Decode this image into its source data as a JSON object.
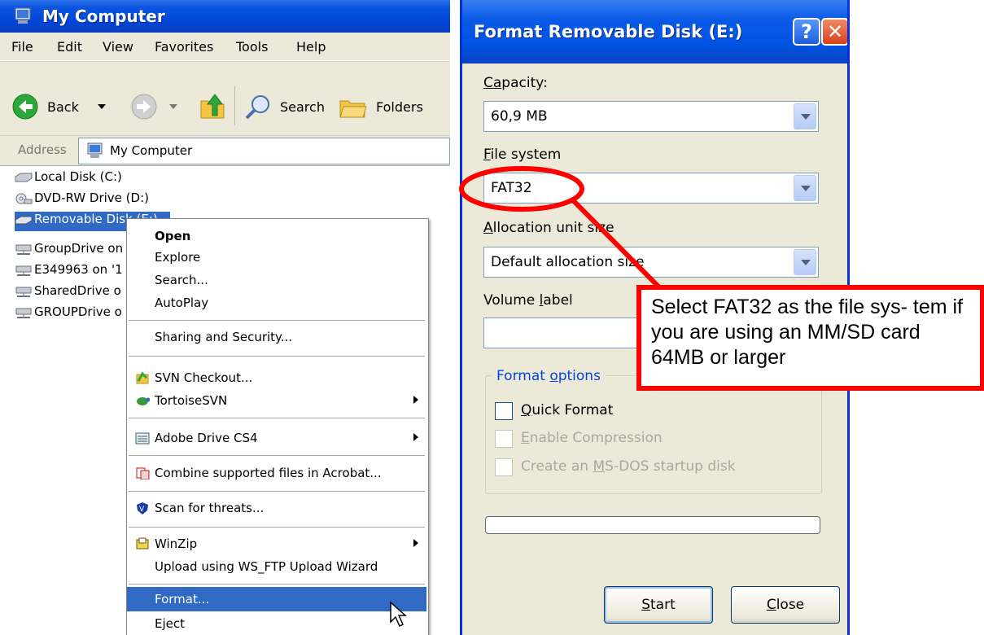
{
  "explorer": {
    "title": "My Computer",
    "menu": [
      "File",
      "Edit",
      "View",
      "Favorites",
      "Tools",
      "Help"
    ],
    "toolbar": {
      "back": "Back",
      "search": "Search",
      "folders": "Folders"
    },
    "address_label": "Address",
    "address_value": "My Computer",
    "drives": [
      "Local Disk (C:)",
      "DVD-RW Drive (D:)",
      "Removable Disk (E:)",
      "GroupDrive on",
      "E349963 on '1",
      "SharedDrive o",
      "GROUPDrive o"
    ]
  },
  "context_menu": {
    "open": "Open",
    "explore": "Explore",
    "search": "Search...",
    "autoplay": "AutoPlay",
    "sharing": "Sharing and Security...",
    "svn_checkout": "SVN Checkout...",
    "tortoise": "TortoiseSVN",
    "adobe_drive": "Adobe Drive CS4",
    "combine": "Combine supported files in Acrobat...",
    "scan": "Scan for threats...",
    "winzip": "WinZip",
    "upload": "Upload using WS_FTP Upload Wizard",
    "format": "Format...",
    "eject": "Eject"
  },
  "dialog": {
    "title": "Format Removable Disk (E:)",
    "help_glyph": "?",
    "close_glyph": "✕",
    "capacity_label": "Capacity:",
    "capacity_value": "60,9 MB",
    "fs_label": "File system",
    "fs_value": "FAT32",
    "alloc_label": "Allocation unit size",
    "alloc_value": "Default allocation size",
    "volume_label": "Volume label",
    "volume_value": "",
    "format_options": "Format options",
    "quick_format": "Quick Format",
    "enable_compression": "Enable Compression",
    "msdos_disk": "Create an MS-DOS startup disk",
    "progress": 0,
    "start": "Start",
    "close": "Close"
  },
  "annotation": {
    "callout_text": "Select FAT32 as the file sys- tem if you are using an MM/SD card 64MB or larger",
    "color": "#ff0000"
  }
}
